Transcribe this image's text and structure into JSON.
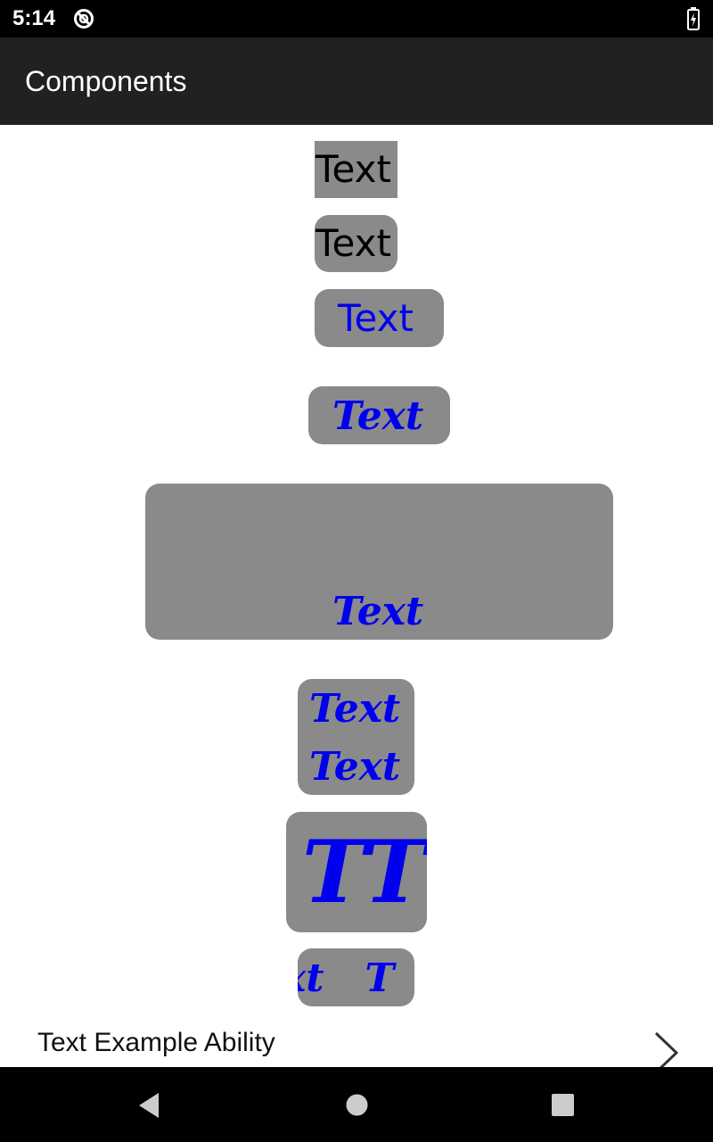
{
  "status_bar": {
    "time": "5:14",
    "icons": [
      "sync-disabled-icon",
      "battery-charging-icon"
    ]
  },
  "app_bar": {
    "title": "Components"
  },
  "text_samples": {
    "plain_square": "Text",
    "plain_rounded": "Text",
    "blue_rounded": "Text",
    "blue_bold_italic": "Text",
    "blue_bold_italic_bottom_aligned": "Text",
    "two_lines": [
      "Text",
      "Text"
    ],
    "large_text": "TT",
    "scrolling_marquee": "ext   T"
  },
  "list": {
    "item_label": "Text Example Ability",
    "item_icon": "chevron-right-icon"
  },
  "nav_bar": {
    "icons": [
      "back-icon",
      "home-icon",
      "recents-icon"
    ]
  },
  "colors": {
    "status_bar": "#000000",
    "app_bar": "#212121",
    "box_background": "#8a8a8a",
    "blue_text": "#0000ee",
    "nav_bar": "#000000"
  }
}
